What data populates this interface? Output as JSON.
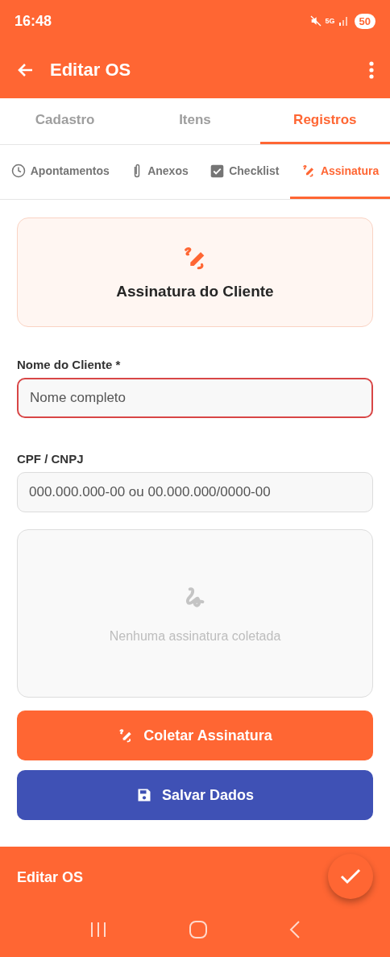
{
  "status_bar": {
    "time": "16:48",
    "network": "5G",
    "battery": "50"
  },
  "app_bar": {
    "title": "Editar OS"
  },
  "tabs": [
    {
      "label": "Cadastro",
      "selected": false
    },
    {
      "label": "Itens",
      "selected": false
    },
    {
      "label": "Registros",
      "selected": true
    }
  ],
  "sub_tabs": [
    {
      "label": "Apontamentos",
      "kind": "clock",
      "selected": false
    },
    {
      "label": "Anexos",
      "kind": "clip",
      "selected": false
    },
    {
      "label": "Checklist",
      "kind": "check",
      "selected": false
    },
    {
      "label": "Assinatura",
      "kind": "signature",
      "selected": true
    }
  ],
  "header_card": {
    "title": "Assinatura do Cliente"
  },
  "fields": [
    {
      "label": "Nome do Cliente *",
      "placeholder": "Nome completo",
      "invalid": true
    },
    {
      "label": "CPF / CNPJ",
      "placeholder": "000.000.000-00 ou 00.000.000/0000-00",
      "invalid": false
    }
  ],
  "signature_pad": {
    "empty_text": "Nenhuma assinatura coletada"
  },
  "buttons": [
    {
      "label": "Coletar Assinatura",
      "kind": "collect"
    },
    {
      "label": "Salvar Dados",
      "kind": "save"
    }
  ],
  "bottom_bar": {
    "title": "Editar OS"
  }
}
